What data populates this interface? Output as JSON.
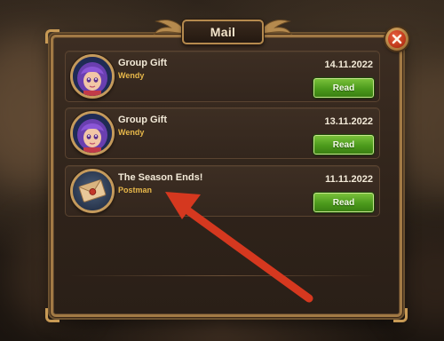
{
  "window": {
    "title": "Mail"
  },
  "mail_items": [
    {
      "title": "Group Gift",
      "sender": "Wendy",
      "date": "14.11.2022",
      "button_label": "Read",
      "avatar": "wendy-portrait"
    },
    {
      "title": "Group Gift",
      "sender": "Wendy",
      "date": "13.11.2022",
      "button_label": "Read",
      "avatar": "wendy-portrait"
    },
    {
      "title": "The Season Ends!",
      "sender": "Postman",
      "date": "11.11.2022",
      "button_label": "Read",
      "avatar": "envelope-icon"
    }
  ],
  "icons": {
    "close": "close-icon",
    "annotation": "red-arrow"
  },
  "colors": {
    "accent_gold": "#c89a55",
    "read_button": "#4c9a1c",
    "close_button": "#c23a1c",
    "sender_text": "#e8b84a",
    "arrow": "#d5381f"
  }
}
